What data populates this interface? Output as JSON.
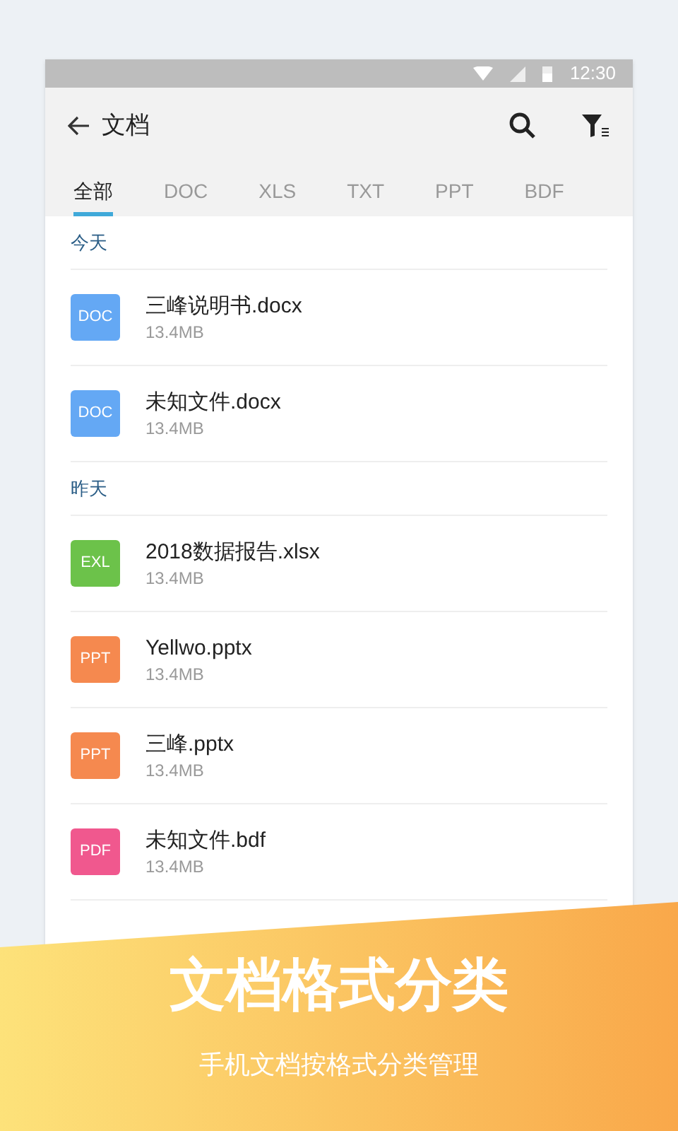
{
  "status_bar": {
    "time": "12:30"
  },
  "toolbar": {
    "title": "文档"
  },
  "tabs": [
    {
      "label": "全部",
      "selected": true
    },
    {
      "label": "DOC",
      "selected": false
    },
    {
      "label": "XLS",
      "selected": false
    },
    {
      "label": "TXT",
      "selected": false
    },
    {
      "label": "PPT",
      "selected": false
    },
    {
      "label": "BDF",
      "selected": false
    }
  ],
  "sections": [
    {
      "title": "今天",
      "files": [
        {
          "badge": "DOC",
          "color": "#64a8f4",
          "name": "三峰说明书.docx",
          "size": "13.4MB"
        },
        {
          "badge": "DOC",
          "color": "#64a8f4",
          "name": "未知文件.docx",
          "size": "13.4MB"
        }
      ]
    },
    {
      "title": "昨天",
      "files": [
        {
          "badge": "EXL",
          "color": "#6cc24a",
          "name": "2018数据报告.xlsx",
          "size": "13.4MB"
        },
        {
          "badge": "PPT",
          "color": "#f5894f",
          "name": "Yellwo.pptx",
          "size": "13.4MB"
        },
        {
          "badge": "PPT",
          "color": "#f5894f",
          "name": "三峰.pptx",
          "size": "13.4MB"
        },
        {
          "badge": "PDF",
          "color": "#f0588e",
          "name": "未知文件.bdf",
          "size": "13.4MB"
        }
      ]
    }
  ],
  "banner": {
    "headline": "文档格式分类",
    "subtitle": "手机文档按格式分类管理"
  }
}
